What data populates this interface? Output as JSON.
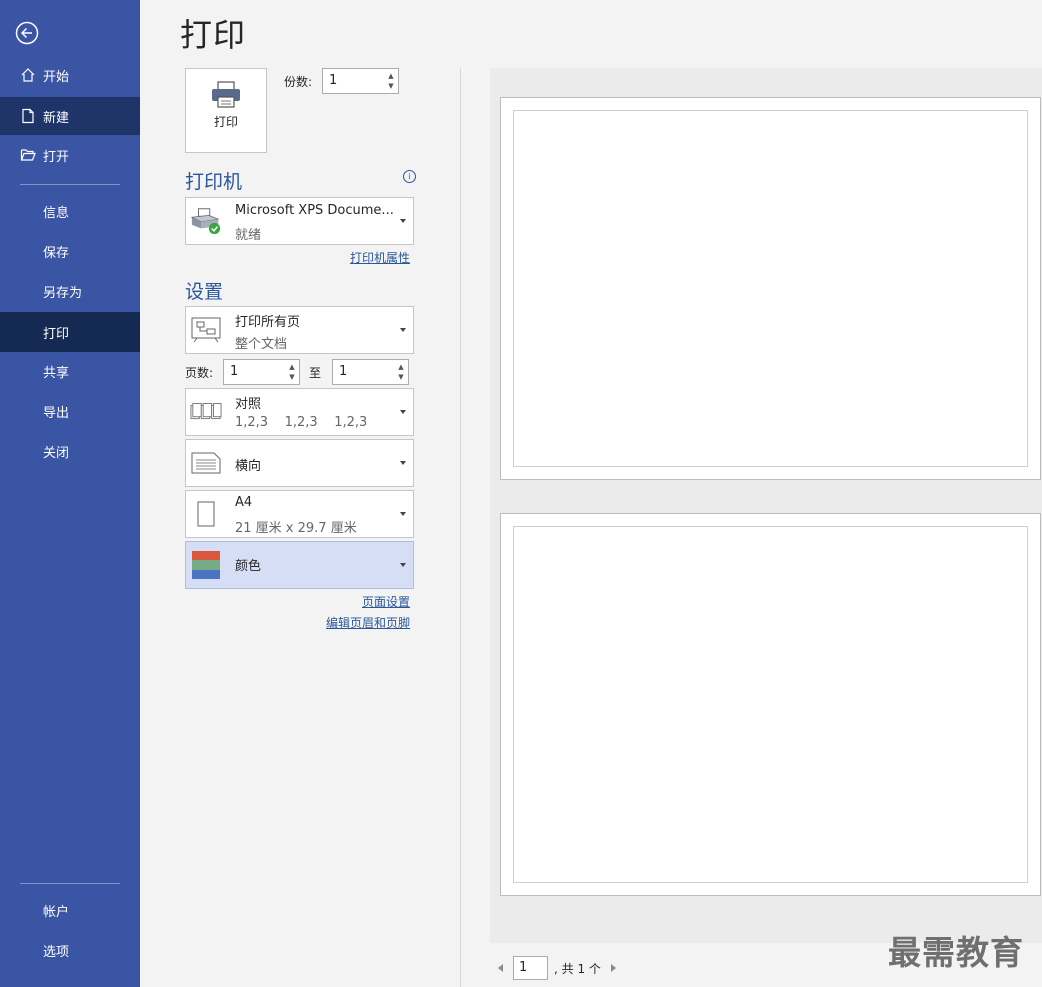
{
  "sidebar": {
    "items": [
      {
        "label": "开始"
      },
      {
        "label": "新建"
      },
      {
        "label": "打开"
      },
      {
        "label": "信息"
      },
      {
        "label": "保存"
      },
      {
        "label": "另存为"
      },
      {
        "label": "打印"
      },
      {
        "label": "共享"
      },
      {
        "label": "导出"
      },
      {
        "label": "关闭"
      },
      {
        "label": "帐户"
      },
      {
        "label": "选项"
      }
    ]
  },
  "main": {
    "title": "打印",
    "print_button_label": "打印",
    "copies_label": "份数:",
    "copies_value": "1",
    "printer_section": "打印机",
    "printer_name": "Microsoft XPS Docume...",
    "printer_status": "就绪",
    "printer_properties_link": "打印机属性",
    "settings_section": "设置",
    "range": {
      "title": "打印所有页",
      "subtitle": "整个文档"
    },
    "pages_label": "页数:",
    "pages_from": "1",
    "to_label": "至",
    "pages_to": "1",
    "collate": {
      "title": "对照",
      "subtitle": "1,2,3    1,2,3    1,2,3"
    },
    "orientation": {
      "title": "横向"
    },
    "paper": {
      "title": "A4",
      "subtitle": "21 厘米 x 29.7 厘米"
    },
    "color": {
      "title": "颜色"
    },
    "page_setup_link": "页面设置",
    "header_footer_link": "编辑页眉和页脚"
  },
  "preview": {
    "page_number": "1",
    "page_count_text": ", 共 1 个"
  },
  "watermark": "最需教育",
  "colors": {
    "sidebar": "#3a55a4",
    "sidebar_selected": "#142a52",
    "accent": "#2b579a",
    "selected_dropdown": "#d5def5"
  }
}
